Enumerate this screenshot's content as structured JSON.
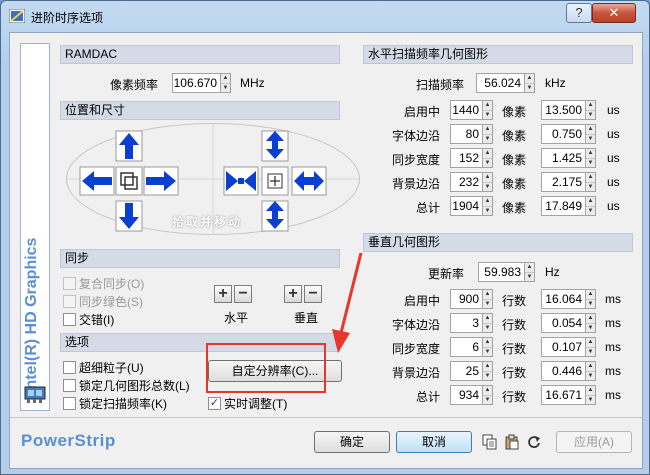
{
  "window": {
    "title": "进阶时序选项",
    "help_label": "?",
    "close_label": "✕"
  },
  "sidebar": {
    "vertical_text": "Intel(R) HD Graphics"
  },
  "ramdac": {
    "header": "RAMDAC",
    "pixel_label": "像素频率",
    "pixel_value": "106.670",
    "pixel_unit": "MHz"
  },
  "position": {
    "header": "位置和尺寸",
    "drag_label": "拾取并移动"
  },
  "sync": {
    "header": "同步",
    "composite": "复合同步(O)",
    "sync_green": "同步绿色(S)",
    "interlace": "交错(I)",
    "h_label": "水平",
    "v_label": "垂直"
  },
  "options": {
    "header": "选项",
    "ultra_fine": "超细粒子(U)",
    "lock_geometry": "锁定几何图形总数(L)",
    "lock_scan": "锁定扫描频率(K)",
    "custom_res": "自定分辨率(C)...",
    "realtime": "实时调整(T)"
  },
  "horizontal": {
    "header": "水平扫描频率几何图形",
    "scan_label": "扫描频率",
    "scan_value": "56.024",
    "scan_unit": "kHz",
    "px_unit": "像素",
    "us_unit": "us",
    "rows": [
      {
        "label": "启用中",
        "px": "1440",
        "us": "13.500"
      },
      {
        "label": "字体边沿",
        "px": "80",
        "us": "0.750"
      },
      {
        "label": "同步宽度",
        "px": "152",
        "us": "1.425"
      },
      {
        "label": "背景边沿",
        "px": "232",
        "us": "2.175"
      },
      {
        "label": "总计",
        "px": "1904",
        "us": "17.849"
      }
    ]
  },
  "vertical": {
    "header": "垂直几何图形",
    "refresh_label": "更新率",
    "refresh_value": "59.983",
    "refresh_unit": "Hz",
    "line_unit": "行数",
    "ms_unit": "ms",
    "rows": [
      {
        "label": "启用中",
        "lines": "900",
        "ms": "16.064"
      },
      {
        "label": "字体边沿",
        "lines": "3",
        "ms": "0.054"
      },
      {
        "label": "同步宽度",
        "lines": "6",
        "ms": "0.107"
      },
      {
        "label": "背景边沿",
        "lines": "25",
        "ms": "0.446"
      },
      {
        "label": "总计",
        "lines": "934",
        "ms": "16.671"
      }
    ]
  },
  "footer": {
    "brand": "PowerStrip",
    "ok": "确定",
    "cancel": "取消",
    "apply": "应用(A)"
  },
  "colors": {
    "accent_blue": "#0a3fd1",
    "sidebar_text": "#5b8fd0",
    "highlight_red": "#e8362a"
  }
}
